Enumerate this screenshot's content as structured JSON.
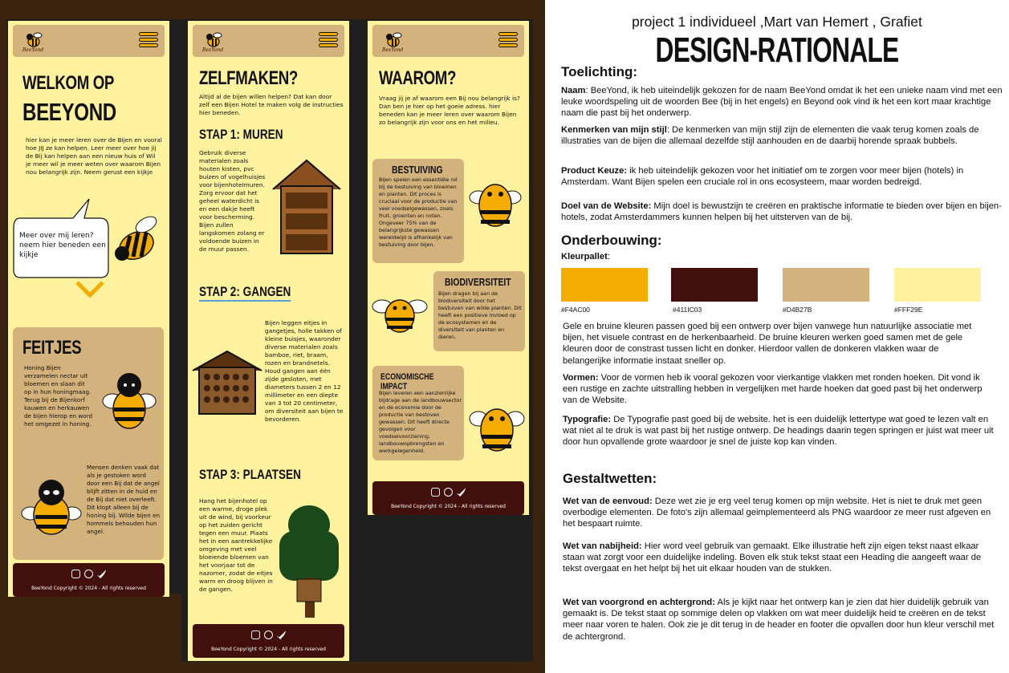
{
  "screen1": {
    "title_line1": "WELKOM OP",
    "title_line2": "BEEYOND",
    "intro": "hier kan je meer leren over de Bijen en vooral hoe JIJ ze kan helpen. Leer meer over hoe jij de Bij kan helpen aan een nieuw huis of Wil je meer wil je meer weten over waarom Bijen nou belangrijk zijn. Neem gerust een kijkje",
    "bubble": "Meer over mij leren? neem hier beneden een kijkje",
    "feitjes_title": "FEITJES",
    "feit1": "Honing Bijen verzamelen nectar uit bloemen en slaan dit op in hun honingmaag. Terug bij de Bijenkorf kauwen en herkauwen de bijen hierop en word het omgezet in honing.",
    "feit2": "Mensen denken vaak dat als je gestoken word door een Bij dat de angel blijft zitten in de huid en de Bij dat niet overleeft. Dit klopt alleen bij de honing bij. Wilde bijen en hommels behouden hun angel."
  },
  "screen2": {
    "title": "ZELFMAKEN?",
    "intro": "Altijd al de bijen willen helpen? Dat kan door zelf een Bijen Hotel te maken volg de instructies hier beneden.",
    "stap1_title": "STAP 1: MUREN",
    "stap1": "Gebruik diverse materialen zoals houten kisten, pvc buizen of vogelhuisjes voor bijenhotelmuren. Zorg ervoor dat het geheel waterdicht is en een dakje heeft voor bescherming. Bijen zullen langskomen zolang er voldoende buizen in de muur passen.",
    "stap2_title": "STAP 2: GANGEN",
    "stap2": "Bijen leggen eitjes in gangetjes, holle takken of kleine buisjes, waaronder diverse materialen zoals bamboe, riet, braam, rozen en brandnetels. Houd gangen aan één zijde gesloten, met diameters tussen 2 en 12 millimeter en een diepte van 3 tot 20 centimeter, om diversiteit aan bijen te bevorderen.",
    "stap3_title": "STAP 3: PLAATSEN",
    "stap3": "Hang het bijenhotel op een warme, droge plek uit de wind, bij voorkeur op het zuiden gericht tegen een muur. Plaats het in een aantrekkelijke omgeving met veel bloeiende bloemen van het voorjaar tot de nazomer, zodat de eitjes warm en droog blijven in de gangen."
  },
  "screen3": {
    "title": "WAAROM?",
    "intro": "Vraag jij je af waarom een Bij nou belangrijk is? Dan ben je hier op het goeie adress. hier beneden kan je meer leren over waarom Bijen zo belangrijk zijn voor ons en het milieu.",
    "b1_title": "BESTUIVING",
    "b1": "Bijen spelen een essentiële rol bij de bestuiving van bloemen en planten. Dit proces is cruciaal voor de productie van veel voedselgewassen, zoals fruit, groenten en noten. Ongeveer 75% van de belangrijkste gewassen wereldwijd is afhankelijk van bestuiving door bijen.",
    "b2_title": "BIODIVERSITEIT",
    "b2": "Bijen dragen bij aan de biodiversiteit door het bestuiven van wilde planten. Dit heeft een positieve invloed op de ecosystemen en de diversiteit van planten en dieren.",
    "b3_title": "ECONOMISCHE IMPACT",
    "b3": "Bijen leveren een aanzienlijke bijdrage aan de landbouwsector en de economie door de productie van bestoven gewassen. Dit heeft directe gevolgen voor voedselvoorziening, landbouwopbrengsten en werkgelegenheid."
  },
  "common": {
    "logo_text": "BeeYond",
    "footer": "BeeYond Copyright © 2024 - All rights reserved"
  },
  "doc": {
    "subtitle": "project 1 individueel ,Mart van Hemert , Grafiet",
    "title": "DESIGN-RATIONALE",
    "toelichting": "Toelichting:",
    "naam_label": "Naam",
    "naam": ": BeeYond, ik heb uiteindelijk gekozen for de naam BeeYond omdat ik het een unieke naam vind met een leuke woordspeling uit de woorden Bee (bij in het engels) en Beyond ook vind ik het een kort maar krachtige naam die past bij het onderwerp.",
    "stijl_label": "Kenmerken van mijn stijl",
    "stijl": ": De kenmerken van mijn stijl zijn de elementen die vaak terug komen zoals de illustraties van de bijen die allemaal dezelfde stijl aanhouden en de daarbij horende spraak bubbels.",
    "keuze_label": "Product Keuze:",
    "keuze": " ik heb uiteindelijk gekozen voor het initiatief om te zorgen voor meer bijen (hotels) in Amsterdam. Want Bijen spelen een cruciale rol in ons ecosysteem, maar worden bedreigd.",
    "doel_label": "Doel van de Website:",
    "doel": " Mijn doel is bewustzijn te creëren en praktische informatie te bieden over bijen en bijen-hotels, zodat Amsterdammers kunnen helpen bij het uitsterven van de bij.",
    "onderbouwing": "Onderbouwing:",
    "kleurpallet_label": "Kleurpallet",
    "kleurpallet_colon": ":",
    "colors": [
      "#F4AC00",
      "#41100C",
      "#D4B27B",
      "#FFF29E"
    ],
    "color_labels": [
      "#F4AC00",
      "#411IC03",
      "#D4B27B",
      "#FFF29E"
    ],
    "kleur_tekst": "Gele en bruine kleuren passen goed bij een ontwerp over bijen vanwege hun natuurlijke associatie met bijen, het visuele contrast en de herkenbaarheid. De bruine kleuren werken goed samen met de gele kleuren door de constrast tussen licht en donker. Hierdoor vallen de donkeren vlakken waar de belangerijke informatie instaat sneller op.",
    "vormen_label": "Vormen:",
    "vormen": " Voor de vormen heb ik vooral gekozen voor vierkantige vlakken met ronden hoeken. Dit vond ik een rustige en zachte uitstralling hebben in vergelijken met harde hoeken dat goed past bij het onderwerp van de Website.",
    "typo_label": "Typografie:",
    "typo": " De Typografie past goed bij de website. het is een duidelijk lettertype wat goed te lezen valt en wat niet al te druk is wat past bij het rustige ontwerp. De headings daarin tegen springen er juist wat meer uit door hun opvallende grote waardoor je snel de juiste kop kan vinden.",
    "gestalt": "Gestaltwetten:",
    "eenvoud_label": "Wet van de eenvoud:",
    "eenvoud": " Deze wet zie je erg veel terug komen op mijn website. Het is niet te druk met geen overbodige elementen. De foto's zijn allemaal geimplementeerd als PNG waardoor ze meer rust afgeven en het bespaart ruimte.",
    "nabij_label": "Wet van nabijheid:",
    "nabij": " Hier word veel gebruik van gemaakt. Elke illustratie heft zijn eigen tekst naast elkaar staan wat zorgt voor een duidelijke indeling. Boven elk stuk tekst staat een Heading die aangeeft waar de tekst overgaat en het helpt bij het uit elkaar houden van de stukken.",
    "voorgrond_label": "Wet van voorgrond en achtergrond:",
    "voorgrond": " Als je kijkt naar het ontwerp kan je zien dat hier duidelijk gebruik van gemaakt is. De tekst staat op sommige delen op vlakken om wat meer duidelijk heid te creëren en de tekst meer naar voren te halen. Ook zie je dit terug in de header en footer die opvallen door hun kleur verschil met de achtergrond."
  }
}
